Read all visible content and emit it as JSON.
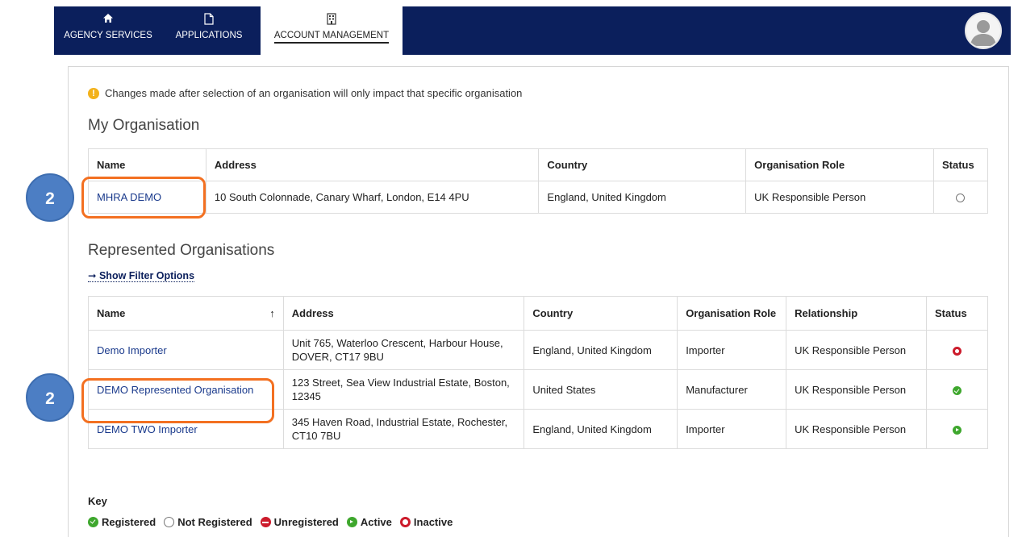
{
  "nav": {
    "items": [
      {
        "label": "AGENCY SERVICES",
        "icon": "home-icon"
      },
      {
        "label": "APPLICATIONS",
        "icon": "document-icon"
      },
      {
        "label": "ACCOUNT MANAGEMENT",
        "icon": "building-icon",
        "active": true
      }
    ],
    "avatar_icon": "user-avatar-icon"
  },
  "notice": "Changes made after selection of an organisation will only impact that specific organisation",
  "my_org": {
    "heading": "My Organisation",
    "columns": [
      "Name",
      "Address",
      "Country",
      "Organisation Role",
      "Status"
    ],
    "rows": [
      {
        "name": "MHRA DEMO",
        "address": "10 South Colonnade, Canary Wharf, London, E14 4PU",
        "country": "England, United Kingdom",
        "role": "UK Responsible Person",
        "status": "Not Registered"
      }
    ]
  },
  "represented": {
    "heading": "Represented Organisations",
    "filter_link": "Show Filter Options",
    "columns": [
      "Name",
      "Address",
      "Country",
      "Organisation Role",
      "Relationship",
      "Status"
    ],
    "sort_arrow": "↑",
    "rows": [
      {
        "name": "Demo Importer",
        "address": "Unit 765, Waterloo Crescent, Harbour House, DOVER, CT17 9BU",
        "country": "England, United Kingdom",
        "role": "Importer",
        "relationship": "UK Responsible Person",
        "status": "Inactive"
      },
      {
        "name": "DEMO Represented Organisation",
        "address": "123 Street, Sea View Industrial Estate, Boston, 12345",
        "country": "United States",
        "role": "Manufacturer",
        "relationship": "UK Responsible Person",
        "status": "Registered"
      },
      {
        "name": "DEMO TWO Importer",
        "address": "345 Haven Road, Industrial Estate, Rochester, CT10 7BU",
        "country": "England, United Kingdom",
        "role": "Importer",
        "relationship": "UK Responsible Person",
        "status": "Active"
      }
    ]
  },
  "key": {
    "title": "Key",
    "items": [
      "Registered",
      "Not Registered",
      "Unregistered",
      "Active",
      "Inactive"
    ]
  },
  "callouts": [
    "2",
    "2"
  ],
  "colors": {
    "nav_bg": "#0b1f5c",
    "link": "#1a3a8c",
    "highlight": "#f37021",
    "callout": "#4c7ec4",
    "green": "#3ea72d",
    "red": "#cc1b2b"
  }
}
